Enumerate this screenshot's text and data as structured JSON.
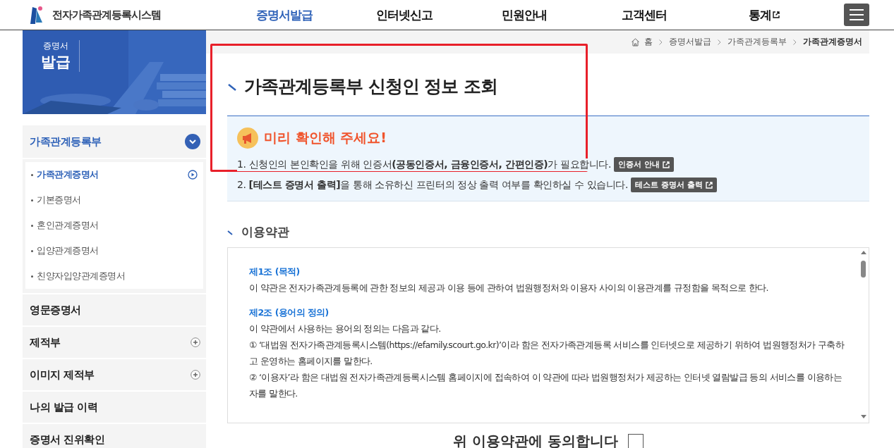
{
  "header": {
    "site_name": "전자가족관계등록시스템",
    "nav": [
      {
        "label": "증명서발급",
        "selected": true,
        "external": false
      },
      {
        "label": "인터넷신고",
        "selected": false,
        "external": false
      },
      {
        "label": "민원안내",
        "selected": false,
        "external": false
      },
      {
        "label": "고객센터",
        "selected": false,
        "external": false
      },
      {
        "label": "통계",
        "selected": false,
        "external": true
      }
    ]
  },
  "sidebar": {
    "banner": [
      "증명서",
      "발급"
    ],
    "menu": [
      {
        "label": "가족관계등록부",
        "kind": "group",
        "expanded": true,
        "children": [
          {
            "label": "가족관계증명서",
            "selected": true
          },
          {
            "label": "기본증명서",
            "selected": false
          },
          {
            "label": "혼인관계증명서",
            "selected": false
          },
          {
            "label": "입양관계증명서",
            "selected": false
          },
          {
            "label": "친양자입양관계증명서",
            "selected": false
          }
        ]
      },
      {
        "label": "영문증명서",
        "kind": "link",
        "expanded": false
      },
      {
        "label": "제적부",
        "kind": "group",
        "expanded": false
      },
      {
        "label": "이미지 제적부",
        "kind": "group",
        "expanded": false
      },
      {
        "label": "나의 발급 이력",
        "kind": "link",
        "expanded": false
      },
      {
        "label": "증명서 진위확인",
        "kind": "link",
        "expanded": false
      }
    ]
  },
  "breadcrumb": [
    "홈",
    "증명서발급",
    "가족관계등록부",
    "가족관계증명서"
  ],
  "title": "가족관계등록부 신청인 정보 조회",
  "notice": {
    "title": "미리 확인해 주세요!",
    "lines": [
      {
        "text": "1. 신청인의 본인확인을 위해 인증서**(공동인증서, 금융인증서, 간편인증)**가 필요합니다.",
        "button": "인증서 안내"
      },
      {
        "text": "2. **[테스트 증명서 출력]**을 통해 소유하신 프린터의 정상 출력 여부를 확인하실 수 있습니다.",
        "button": "테스트 증명서 출력"
      }
    ]
  },
  "terms": {
    "heading": "이용약관",
    "sections": [
      {
        "heading": "제1조 (목적)",
        "paragraphs": [
          "이 약관은 전자가족관계등록에 관한 정보의 제공과 이용 등에 관하여 법원행정처와 이용자 사이의 이용관계를 규정함을 목적으로 한다."
        ]
      },
      {
        "heading": "제2조 (용어의 정의)",
        "paragraphs": [
          "이 약관에서 사용하는 용어의 정의는 다음과 같다.",
          "① ‘대법원 전자가족관계등록시스템(https://efamily.scourt.go.kr)’이라 함은 전자가족관계등록 서비스를 인터넷으로 제공하기 위하여 법원행정처가 구축하고 운영하는 홈페이지를 말한다.",
          "② ‘이용자’라 함은 대법원 전자가족관계등록시스템 홈페이지에 접속하여 이 약관에 따라 법원행정처가 제공하는 인터넷 열람발급 등의 서비스를 이용하는 자를 말한다."
        ]
      }
    ]
  },
  "agreement": {
    "label": "위 이용약관에 동의합니다",
    "checked": false
  }
}
